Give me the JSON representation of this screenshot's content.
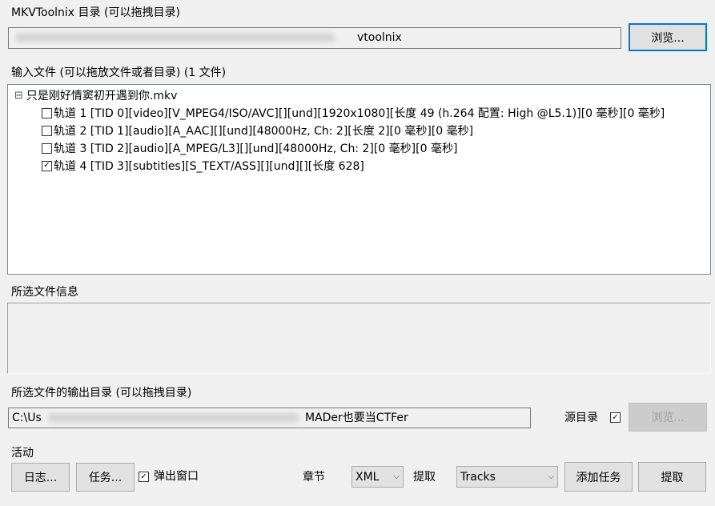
{
  "mkvtoolnix_dir": {
    "label": "MKVToolnix 目录 (可以拖拽目录)",
    "path_end": "vtoolnix",
    "browse": "浏览..."
  },
  "input": {
    "label": "输入文件 (可以拖放文件或者目录) (1 文件)",
    "file_name": "只是刚好情窦初开遇到你.mkv",
    "expander": "⊟",
    "tracks": [
      {
        "checked": false,
        "text": "轨道 1 [TID 0][video][V_MPEG4/ISO/AVC][][und][1920x1080][长度 49 (h.264 配置: High @L5.1)][0 毫秒][0 毫秒]"
      },
      {
        "checked": false,
        "text": "轨道 2 [TID 1][audio][A_AAC][][und][48000Hz, Ch: 2][长度 2][0 毫秒][0 毫秒]"
      },
      {
        "checked": false,
        "text": "轨道 3 [TID 2][audio][A_MPEG/L3][][und][48000Hz, Ch: 2][0 毫秒][0 毫秒]"
      },
      {
        "checked": true,
        "text": "轨道 4 [TID 3][subtitles][S_TEXT/ASS][][und][][长度 628]"
      }
    ]
  },
  "file_info": {
    "label": "所选文件信息"
  },
  "output": {
    "label": "所选文件的输出目录 (可以拖拽目录)",
    "path_start": "C:\\Us",
    "path_end": "MADer也要当CTFer",
    "source_dir_label": "源目录",
    "source_dir_checked": true,
    "browse": "浏览..."
  },
  "activity": {
    "label": "活动",
    "log_button": "日志...",
    "tasks_button": "任务...",
    "popup_label": "弹出窗口",
    "popup_checked": true,
    "chapters_label": "章节",
    "chapters_format": "XML",
    "extract_label": "提取",
    "extract_mode": "Tracks",
    "add_task_button": "添加任务",
    "extract_button": "提取"
  }
}
